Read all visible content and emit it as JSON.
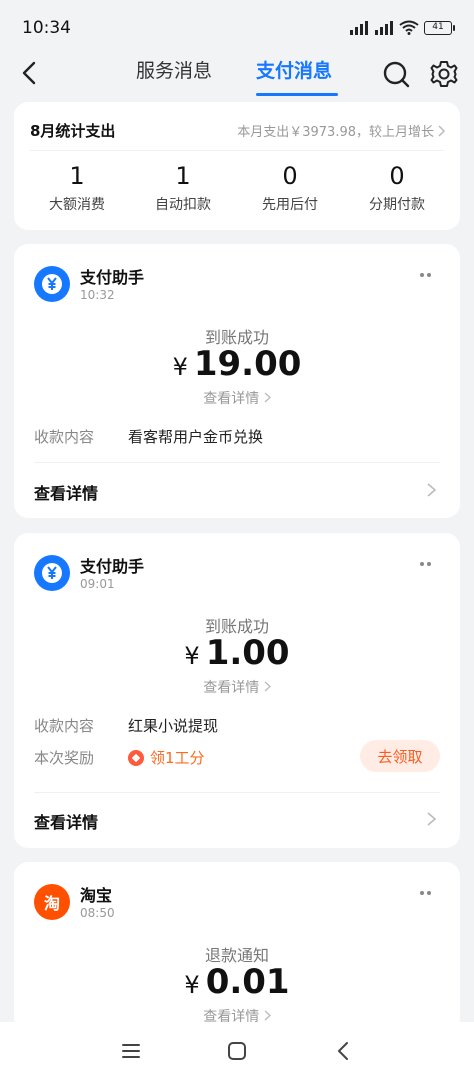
{
  "status_bar": {
    "time": "10:34",
    "battery": "41"
  },
  "header": {
    "tab_service": "服务消息",
    "tab_pay": "支付消息"
  },
  "summary": {
    "title": "8月统计支出",
    "right_text": "本月支出￥3973.98，较上月增长",
    "stats": [
      {
        "value": "1",
        "label": "大额消费"
      },
      {
        "value": "1",
        "label": "自动扣款"
      },
      {
        "value": "0",
        "label": "先用后付"
      },
      {
        "value": "0",
        "label": "分期付款"
      }
    ]
  },
  "messages": [
    {
      "sender": "支付助手",
      "time": "10:32",
      "icon": "yuan-icon",
      "icon_color": "#1677ff",
      "status": "到账成功",
      "currency": "¥",
      "amount": "19.00",
      "detail_link": "查看详情",
      "rows": [
        {
          "label": "收款内容",
          "value": "看客帮用户金币兑换"
        }
      ],
      "view_detail": "查看详情"
    },
    {
      "sender": "支付助手",
      "time": "09:01",
      "icon": "yuan-icon",
      "icon_color": "#1677ff",
      "status": "到账成功",
      "currency": "¥",
      "amount": "1.00",
      "detail_link": "查看详情",
      "rows": [
        {
          "label": "收款内容",
          "value": "红果小说提现"
        }
      ],
      "reward": {
        "label": "本次奖励",
        "value": "领1工分",
        "button": "去领取"
      },
      "view_detail": "查看详情"
    },
    {
      "sender": "淘宝",
      "time": "08:50",
      "icon": "taobao-icon",
      "icon_color": "#ff5000",
      "icon_text": "淘",
      "status": "退款通知",
      "currency": "¥",
      "amount": "0.01",
      "detail_link": "查看详情"
    }
  ]
}
